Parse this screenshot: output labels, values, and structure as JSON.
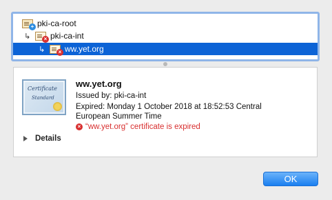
{
  "chain": {
    "items": [
      {
        "label": "pki-ca-root",
        "icon": "root-certificate-icon"
      },
      {
        "label": "pki-ca-int",
        "icon": "invalid-certificate-icon"
      },
      {
        "label": "ww.yet.org",
        "icon": "invalid-certificate-icon",
        "selected": true
      }
    ]
  },
  "detail": {
    "cert_image_text1": "Certificate",
    "cert_image_text2": "Standard",
    "common_name": "ww.yet.org",
    "issued_by": "Issued by: pki-ca-int",
    "expired_line1": "Expired: Monday 1 October 2018 at 18:52:53 Central",
    "expired_line2": "European Summer Time",
    "error": "“ww.yet.org” certificate is expired",
    "details_label": "Details"
  },
  "buttons": {
    "ok_label": "OK"
  },
  "colors": {
    "selection": "#0c63d6",
    "error": "#d82f2f",
    "focus_ring": "#8fb5e8"
  }
}
